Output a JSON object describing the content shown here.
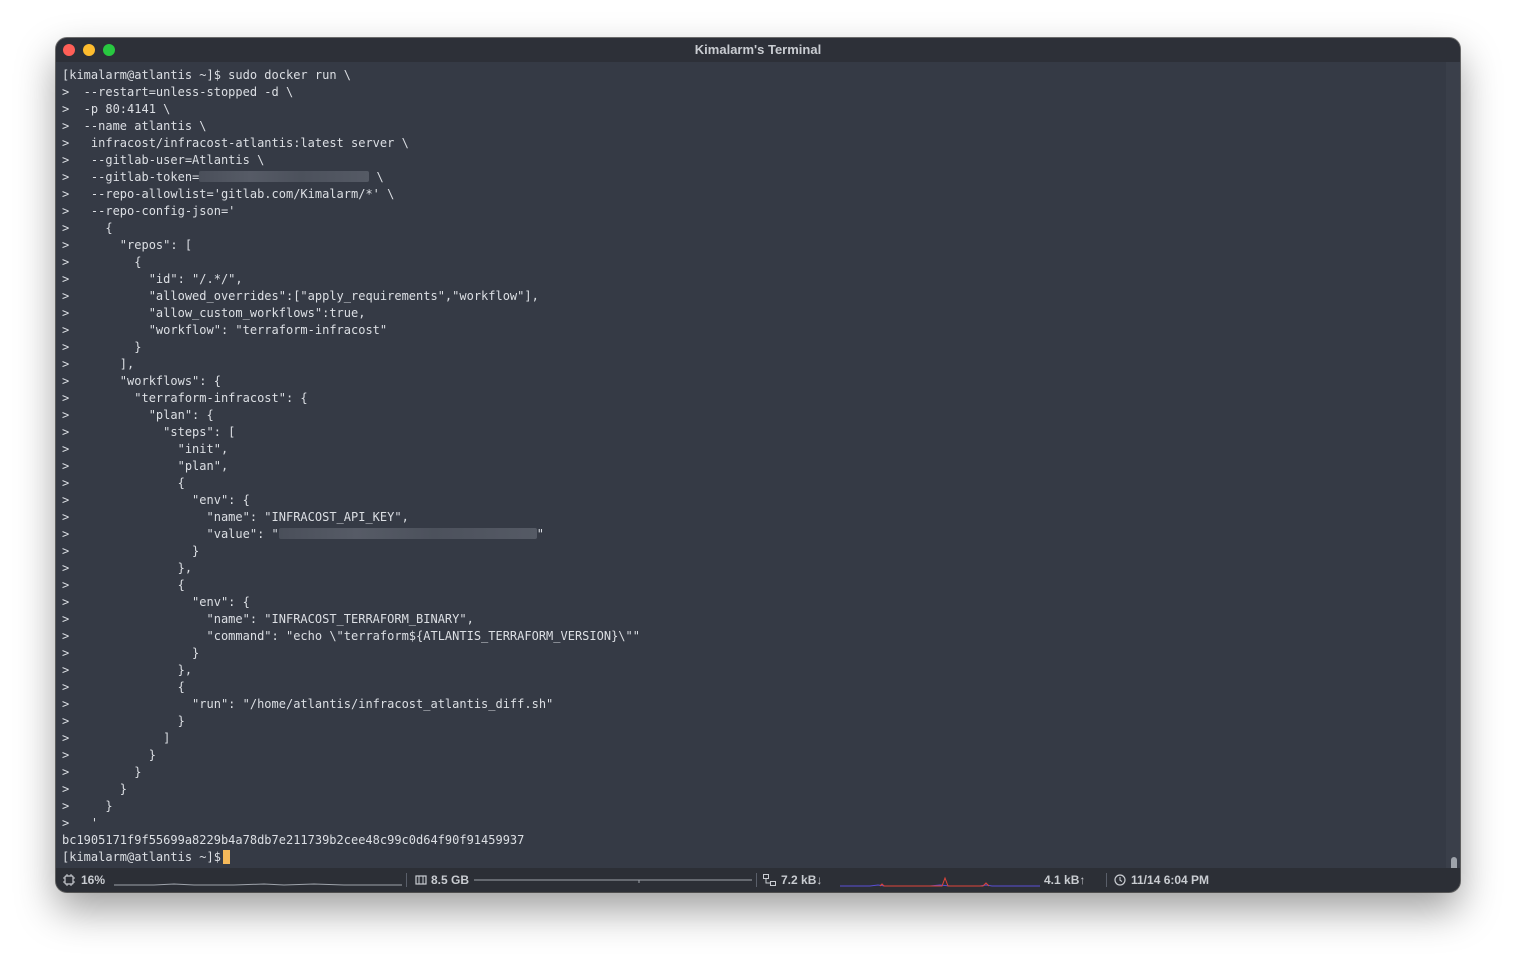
{
  "window": {
    "title": "Kimalarm's Terminal"
  },
  "terminal": {
    "prompt": "[kimalarm@atlantis ~]$",
    "command_first": " sudo docker run \\",
    "cont": ">",
    "lines": [
      "  --restart=unless-stopped -d \\",
      "  -p 80:4141 \\",
      "  --name atlantis \\",
      "   infracost/infracost-atlantis:latest server \\",
      "   --gitlab-user=Atlantis \\"
    ],
    "token_prefix": "   --gitlab-token=",
    "token_suffix": " \\",
    "lines2": [
      "   --repo-allowlist='gitlab.com/Kimalarm/*' \\",
      "   --repo-config-json='",
      "     {",
      "       \"repos\": [",
      "         {",
      "           \"id\": \"/.*/\",",
      "           \"allowed_overrides\":[\"apply_requirements\",\"workflow\"],",
      "           \"allow_custom_workflows\":true,",
      "           \"workflow\": \"terraform-infracost\"",
      "         }",
      "       ],",
      "       \"workflows\": {",
      "         \"terraform-infracost\": {",
      "           \"plan\": {",
      "             \"steps\": [",
      "               \"init\",",
      "               \"plan\",",
      "               {",
      "                 \"env\": {",
      "                   \"name\": \"INFRACOST_API_KEY\","
    ],
    "value_prefix": "                   \"value\": \"",
    "value_suffix": "\"",
    "lines3": [
      "                 }",
      "               },",
      "               {",
      "                 \"env\": {",
      "                   \"name\": \"INFRACOST_TERRAFORM_BINARY\",",
      "                   \"command\": \"echo \\\"terraform${ATLANTIS_TERRAFORM_VERSION}\\\"\"",
      "                 }",
      "               },",
      "               {",
      "                 \"run\": \"/home/atlantis/infracost_atlantis_diff.sh\"",
      "               }",
      "             ]",
      "           }",
      "         }",
      "       }",
      "     }",
      "   '"
    ],
    "container_id": "bc1905171f9f55699a8229b4a78db7e211739b2cee48c99c0d64f90f91459937"
  },
  "statusbar": {
    "cpu": "16%",
    "memory": "8.5 GB",
    "net_down": "7.2 kB↓",
    "net_up": "4.1 kB↑",
    "datetime": "11/14 6:04 PM"
  },
  "icons": [
    "close-button",
    "minimize-button",
    "zoom-button",
    "cpu-icon",
    "memory-icon",
    "network-icon",
    "clock-icon"
  ],
  "colors": {
    "terminal_bg": "#353a45",
    "text": "#dcdfe4",
    "cursor": "#f5b95a",
    "net_graph_down": "#5a4fd6",
    "net_graph_up": "#e0443a"
  }
}
